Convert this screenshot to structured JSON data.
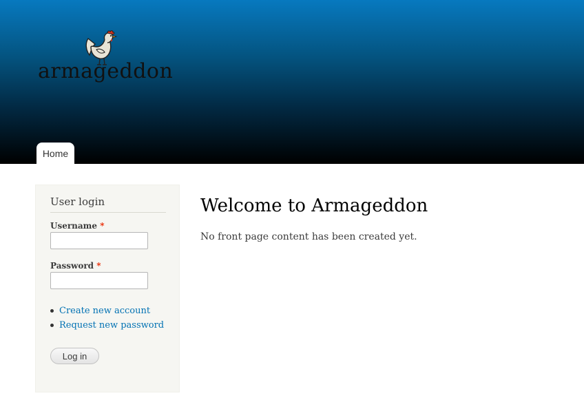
{
  "header": {
    "site_name": "armageddon",
    "logo_icon": "rooster-icon",
    "gradient_top": "#0779bf",
    "gradient_bottom": "#000000"
  },
  "nav": {
    "tabs": [
      {
        "label": "Home",
        "active": true
      }
    ]
  },
  "sidebar": {
    "title": "User login",
    "username_label": "Username",
    "password_label": "Password",
    "required_mark": "*",
    "username_value": "",
    "password_value": "",
    "links": [
      {
        "label": "Create new account"
      },
      {
        "label": "Request new password"
      }
    ],
    "login_button": "Log in"
  },
  "main": {
    "title": "Welcome to Armageddon",
    "text": "No front page content has been created yet."
  },
  "colors": {
    "link": "#0071b3",
    "required": "#ea2800",
    "sidebar_bg": "#f6f6f2"
  }
}
